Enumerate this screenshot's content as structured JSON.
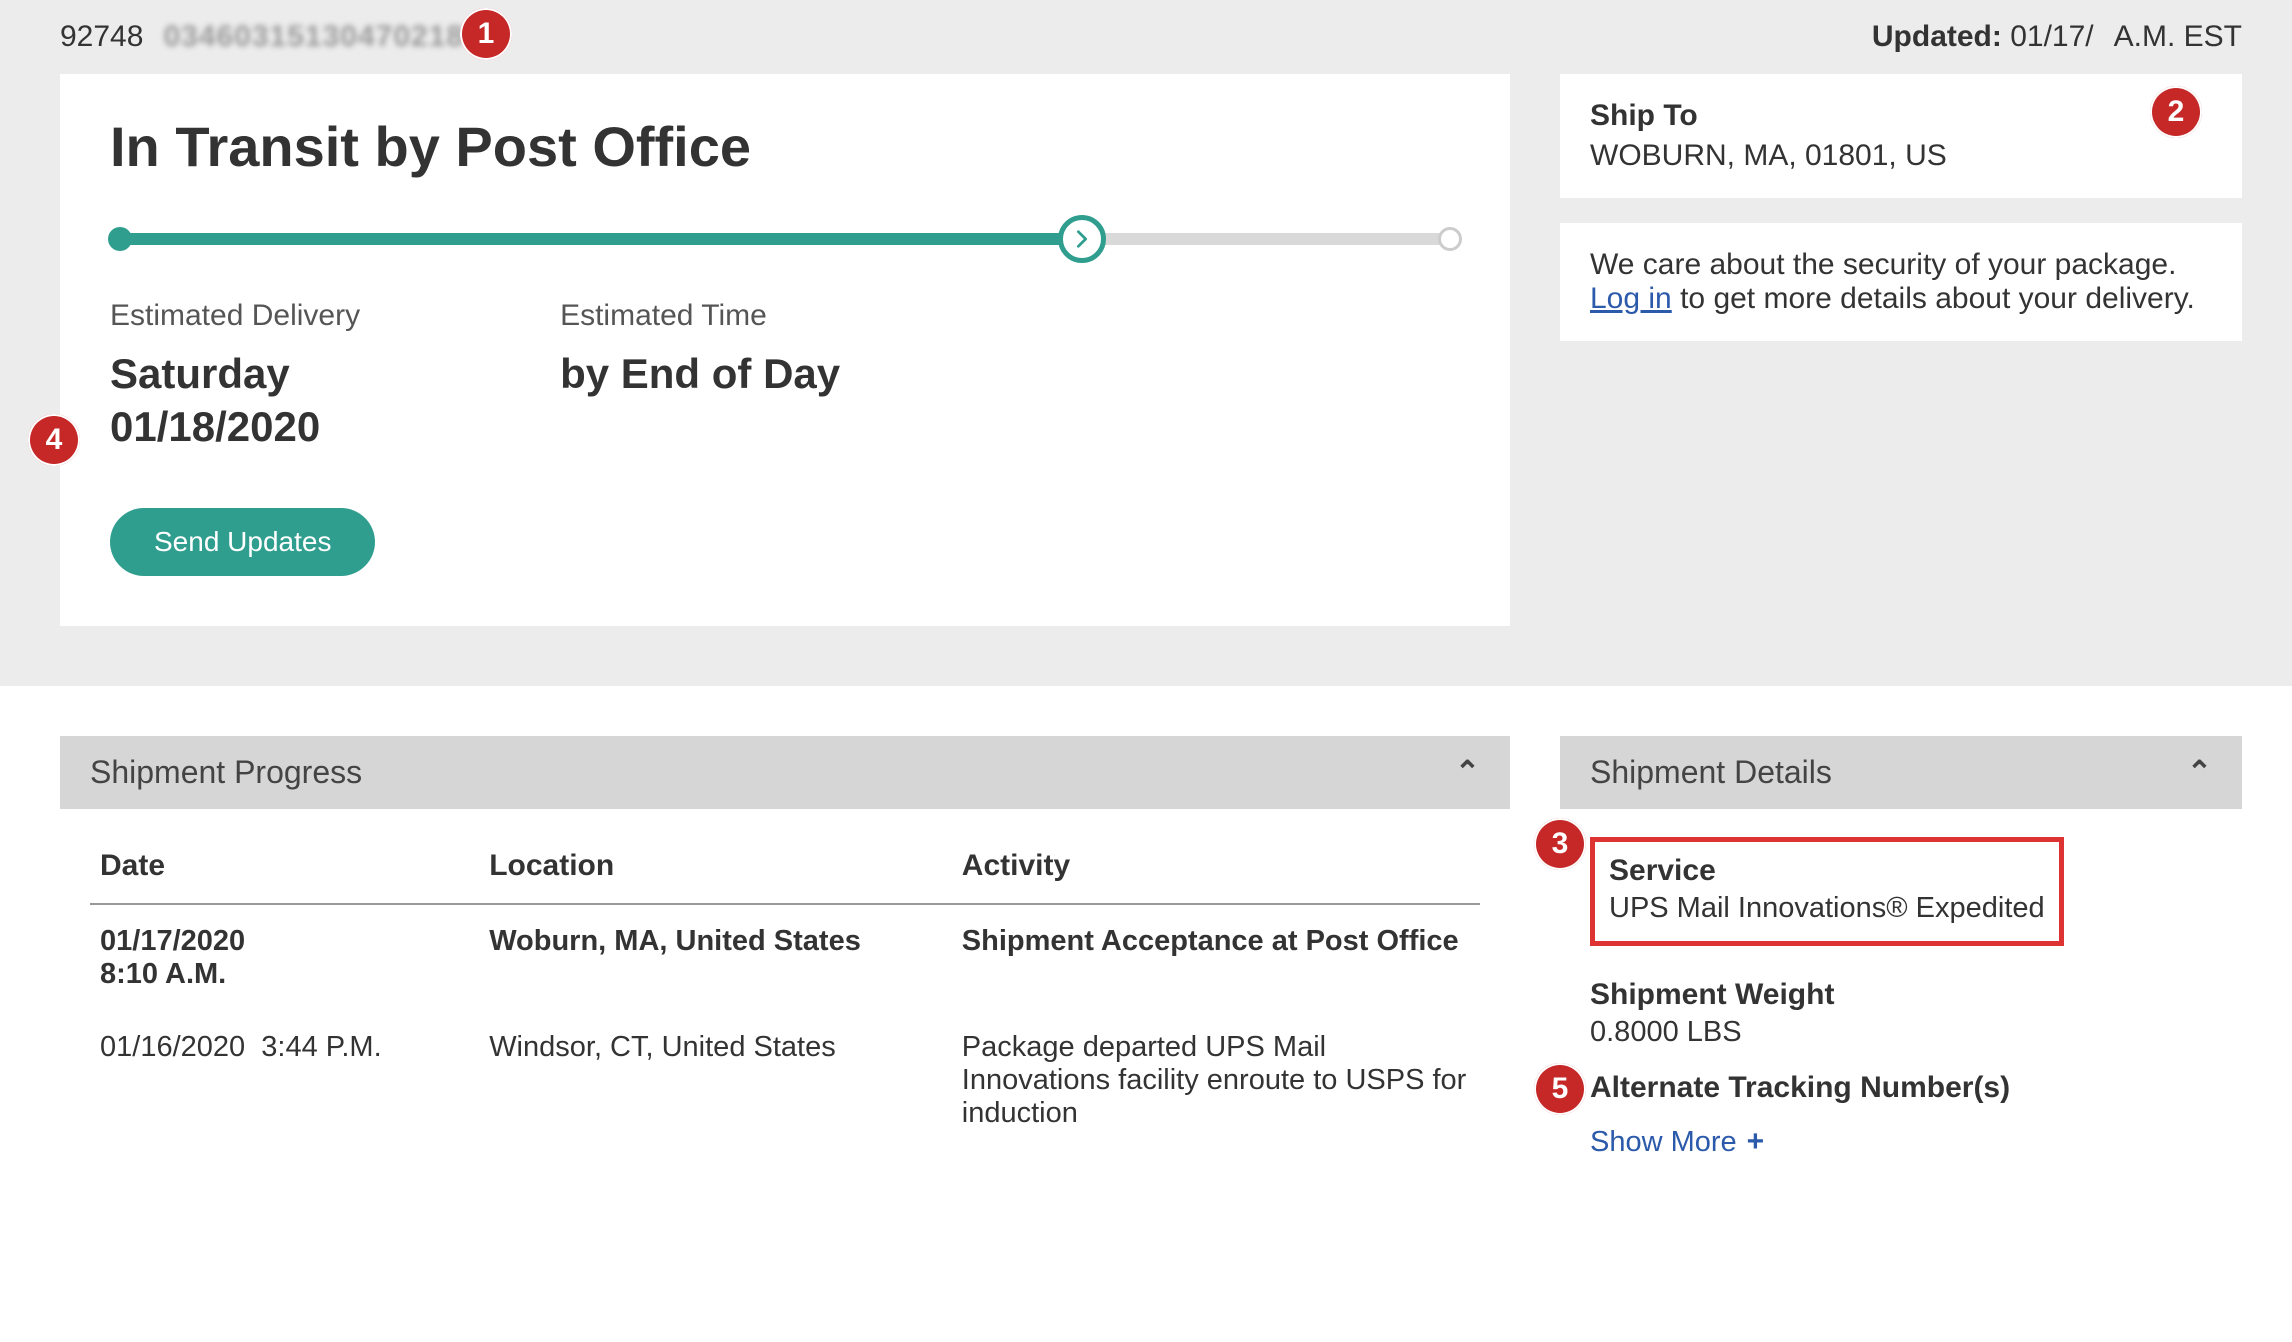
{
  "annotations": {
    "a1": "1",
    "a2": "2",
    "a3": "3",
    "a4": "4",
    "a5": "5"
  },
  "topbar": {
    "tracking_prefix": "92748",
    "tracking_rest_obscured": "0346031513047021873",
    "updated_label": "Updated:",
    "updated_date": "01/17/",
    "updated_tz": "A.M. EST"
  },
  "status": {
    "title": "In Transit by Post Office",
    "progress_percent": 72,
    "est_delivery_label": "Estimated Delivery",
    "est_delivery_day": "Saturday",
    "est_delivery_date": "01/18/2020",
    "est_time_label": "Estimated Time",
    "est_time_value": "by End of Day",
    "send_updates_label": "Send Updates"
  },
  "ship_to": {
    "title": "Ship To",
    "address": "WOBURN, MA, 01801, US"
  },
  "security_msg": {
    "pre": "We care about the security of your package. ",
    "link": "Log in",
    "post": " to get more details about your delivery."
  },
  "shipment_progress": {
    "header": "Shipment Progress",
    "cols": {
      "date": "Date",
      "location": "Location",
      "activity": "Activity"
    },
    "rows": [
      {
        "date": "01/17/2020",
        "time": "8:10 A.M.",
        "location": "Woburn, MA, United States",
        "activity": "Shipment Acceptance at Post Office",
        "current": true
      },
      {
        "date": "01/16/2020",
        "time": "3:44 P.M.",
        "location": "Windsor, CT, United States",
        "activity": "Package departed UPS Mail Innovations facility enroute to USPS for induction",
        "current": false
      }
    ]
  },
  "shipment_details": {
    "header": "Shipment Details",
    "service_label": "Service",
    "service_value": "UPS Mail Innovations® Expedited",
    "weight_label": "Shipment Weight",
    "weight_value": "0.8000 LBS",
    "alt_tracking_label": "Alternate Tracking Number(s)",
    "show_more": "Show More"
  },
  "colors": {
    "accent": "#2f9e8f",
    "annot": "#c62828",
    "link": "#2b5aab"
  }
}
